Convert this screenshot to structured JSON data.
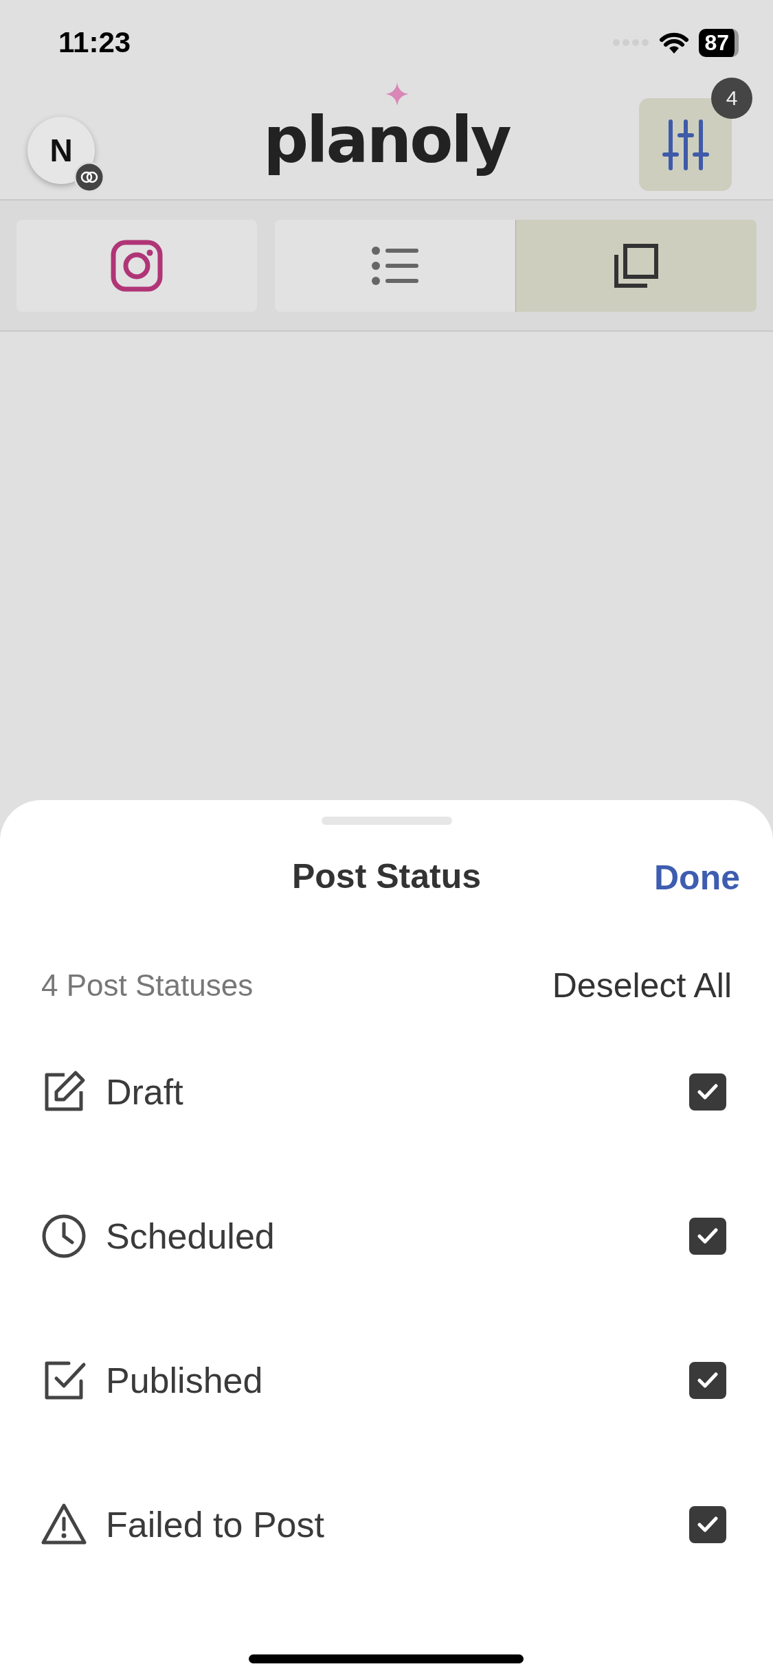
{
  "status_bar": {
    "time": "11:23",
    "battery": "87"
  },
  "header": {
    "avatar": "N",
    "logo": "planoly",
    "filter_badge": "4"
  },
  "tabs": [
    {
      "kind": "instagram",
      "selected": false
    },
    {
      "kind": "list",
      "selected": false
    },
    {
      "kind": "stack",
      "selected": true
    }
  ],
  "sheet": {
    "title": "Post Status",
    "done": "Done",
    "count": "4 Post Statuses",
    "deselect": "Deselect All",
    "statuses": [
      {
        "kind": "draft",
        "label": "Draft",
        "checked": true
      },
      {
        "kind": "scheduled",
        "label": "Scheduled",
        "checked": true
      },
      {
        "kind": "published",
        "label": "Published",
        "checked": true
      },
      {
        "kind": "failed",
        "label": "Failed to Post",
        "checked": true
      }
    ]
  }
}
